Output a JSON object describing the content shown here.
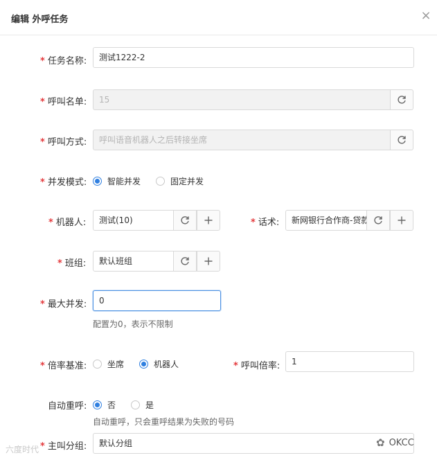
{
  "dialog": {
    "title": "编辑 外呼任务",
    "close_glyph": "×"
  },
  "form": {
    "task_name": {
      "label": "任务名称:",
      "value": "测试1222-2"
    },
    "call_list": {
      "label": "呼叫名单:",
      "value": "15"
    },
    "call_method": {
      "label": "呼叫方式:",
      "value": "呼叫语音机器人之后转接坐席"
    },
    "concurrency_mode": {
      "label": "并发模式:",
      "options": [
        "智能并发",
        "固定并发"
      ],
      "selected": "智能并发"
    },
    "robot": {
      "label": "机器人:",
      "value": "测试(10)"
    },
    "script": {
      "label": "话术:",
      "value": "新网银行合作商-贷款"
    },
    "team": {
      "label": "班组:",
      "value": "默认班组"
    },
    "max_concurrency": {
      "label": "最大并发:",
      "value": "0",
      "hint": "配置为0，表示不限制"
    },
    "rate_basis": {
      "label": "倍率基准:",
      "options": [
        "坐席",
        "机器人"
      ],
      "selected": "机器人"
    },
    "call_rate": {
      "label": "呼叫倍率:",
      "value": "1"
    },
    "auto_redial": {
      "label": "自动重呼:",
      "options": [
        "否",
        "是"
      ],
      "selected": "否",
      "hint": "自动重呼，只会重呼结果为失败的号码"
    },
    "main_group": {
      "label": "主叫分组:",
      "value": "默认分组"
    },
    "required_mark": "*"
  },
  "icons": {
    "refresh": "refresh-icon",
    "add": "plus-icon",
    "close": "close-icon"
  },
  "watermarks": {
    "left": "六度时代",
    "right": "OKCC"
  },
  "colors": {
    "accent": "#2f7fe0",
    "required": "#e4393c",
    "disabled_bg": "#f2f2f2",
    "focus_border": "#4a90e2"
  }
}
